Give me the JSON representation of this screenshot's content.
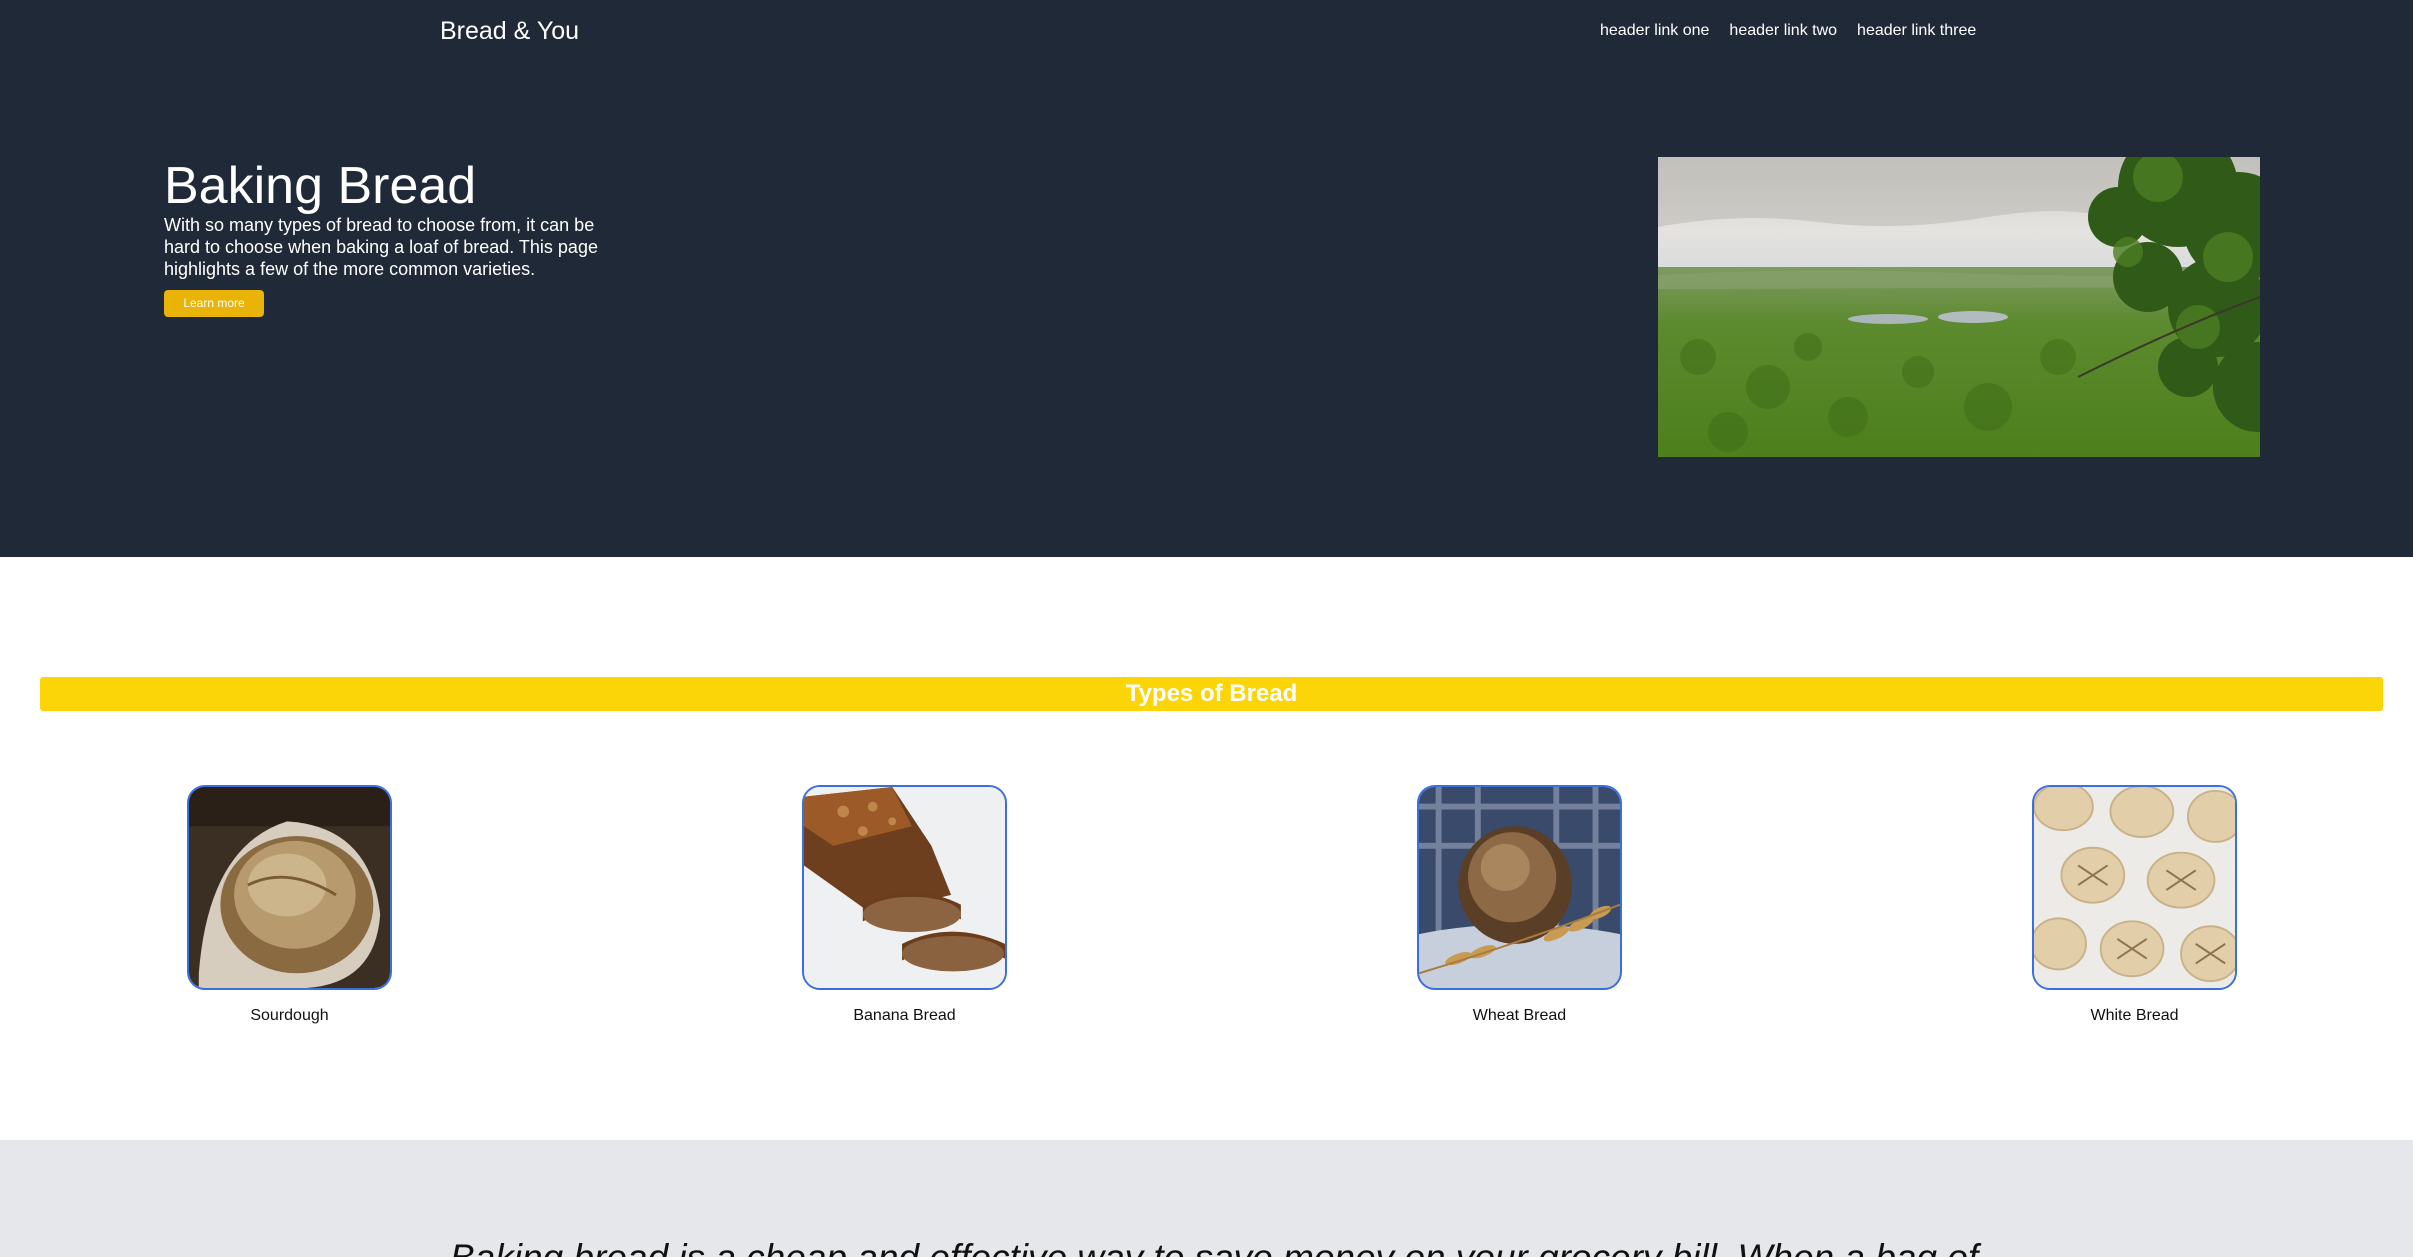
{
  "header": {
    "brand": "Bread & You",
    "links": [
      "header link one",
      "header link two",
      "header link three"
    ]
  },
  "hero": {
    "title": "Baking Bread",
    "text": "With so many types of bread to choose from, it can be hard to choose when baking a loaf of bread. This page highlights a few of the more common varieties.",
    "button_label": "Learn more"
  },
  "types": {
    "title": "Types of Bread",
    "items": [
      "Sourdough",
      "Banana Bread",
      "Wheat Bread",
      "White Bread"
    ]
  },
  "quote": {
    "text": "Baking bread is a cheap and effective way to save money on your grocery bill. When a bag of"
  },
  "colors": {
    "hero_bg": "#1f2937",
    "accent_yellow": "#fcd508",
    "button": "#eab308",
    "card_border": "#3b6fe0",
    "quote_bg": "#e5e7eb"
  }
}
